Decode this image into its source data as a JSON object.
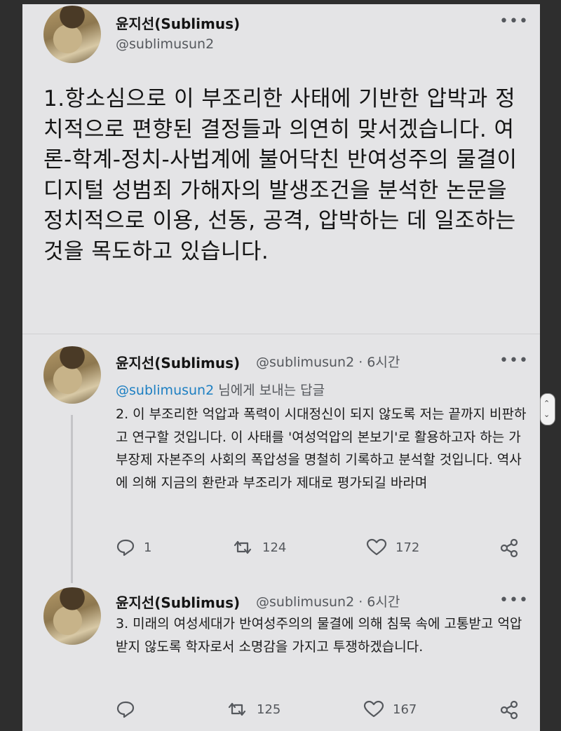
{
  "main_tweet": {
    "name": "윤지선(Sublimus)",
    "handle": "@sublimusun2",
    "text": "1.항소심으로 이 부조리한 사태에 기반한 압박과 정치적으로 편향된 결정들과 의연히 맞서겠습니다. 여론-학계-정치-사법계에 불어닥친 반여성주의 물결이 디지털 성범죄 가해자의 발생조건을 분석한 논문을 정치적으로 이용, 선동, 공격, 압박하는 데 일조하는 것을 목도하고 있습니다."
  },
  "reply1": {
    "name": "윤지선(Sublimus)",
    "meta": "@sublimusun2 · 6시간",
    "reply_mention": "@sublimusun2",
    "reply_suffix": " 님에게 보내는 답글",
    "text": "2. 이 부조리한 억압과 폭력이 시대정신이 되지 않도록 저는 끝까지  비판하고 연구할 것입니다. 이 사태를 '여성억압의 본보기'로 활용하고자 하는 가부장제 자본주의 사회의 폭압성을 명철히 기록하고 분석할 것입니다. 역사에 의해 지금의 환란과 부조리가 제대로 평가되길 바라며",
    "replies": "1",
    "retweets": "124",
    "likes": "172"
  },
  "reply2": {
    "name": "윤지선(Sublimus)",
    "meta": "@sublimusun2 · 6시간",
    "text": "3. 미래의 여성세대가 반여성주의의 물결에 의해 침묵 속에 고통받고 억압받지 않도록 학자로서 소명감을 가지고 투쟁하겠습니다.",
    "retweets": "125",
    "likes": "167"
  },
  "icons": {
    "more": "more-icon",
    "reply": "reply-icon",
    "retweet": "retweet-icon",
    "like": "heart-icon",
    "share": "share-icon"
  }
}
